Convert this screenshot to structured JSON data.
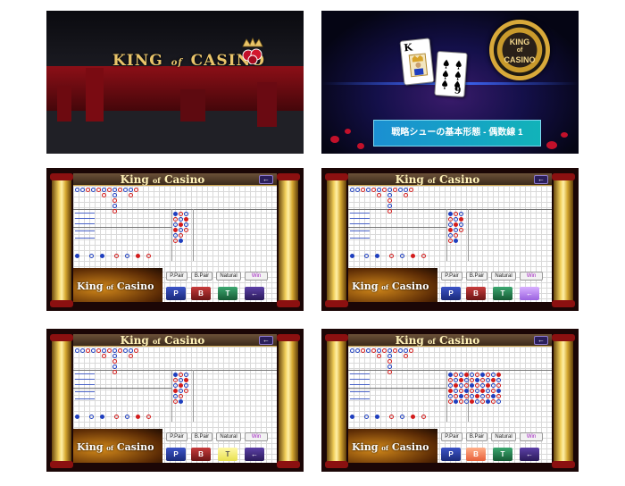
{
  "intro": {
    "logo": {
      "king": "KING",
      "of": "of",
      "casino": "CASINO"
    }
  },
  "title_card": {
    "card1": {
      "rank": "K"
    },
    "card2": {
      "rank": "6"
    },
    "chip": {
      "king": "KING",
      "of": "of",
      "casino": "CASINO"
    },
    "subtitle": "戦略シューの基本形態 - 偶数線 1"
  },
  "screens": [
    {
      "active": "none"
    },
    {
      "active": "back"
    },
    {
      "active": "tie"
    },
    {
      "active": "banker"
    }
  ],
  "game": {
    "title_king": "King",
    "title_of": "of",
    "title_casino": "Casino",
    "back_icon": "←",
    "promo_king": "King",
    "promo_of": "of",
    "promo_casino": "Casino",
    "p_pair": "P.Pair",
    "b_pair": "B.Pair",
    "natural": "Natural",
    "win": "Win",
    "player_btn": "P",
    "banker_btn": "B",
    "tie_btn": "T",
    "back_btn": "←"
  },
  "colors": {
    "player": "#1f3fbf",
    "banker": "#d21c1c",
    "tie": "#3ca870",
    "gold": "#e9c46a"
  }
}
